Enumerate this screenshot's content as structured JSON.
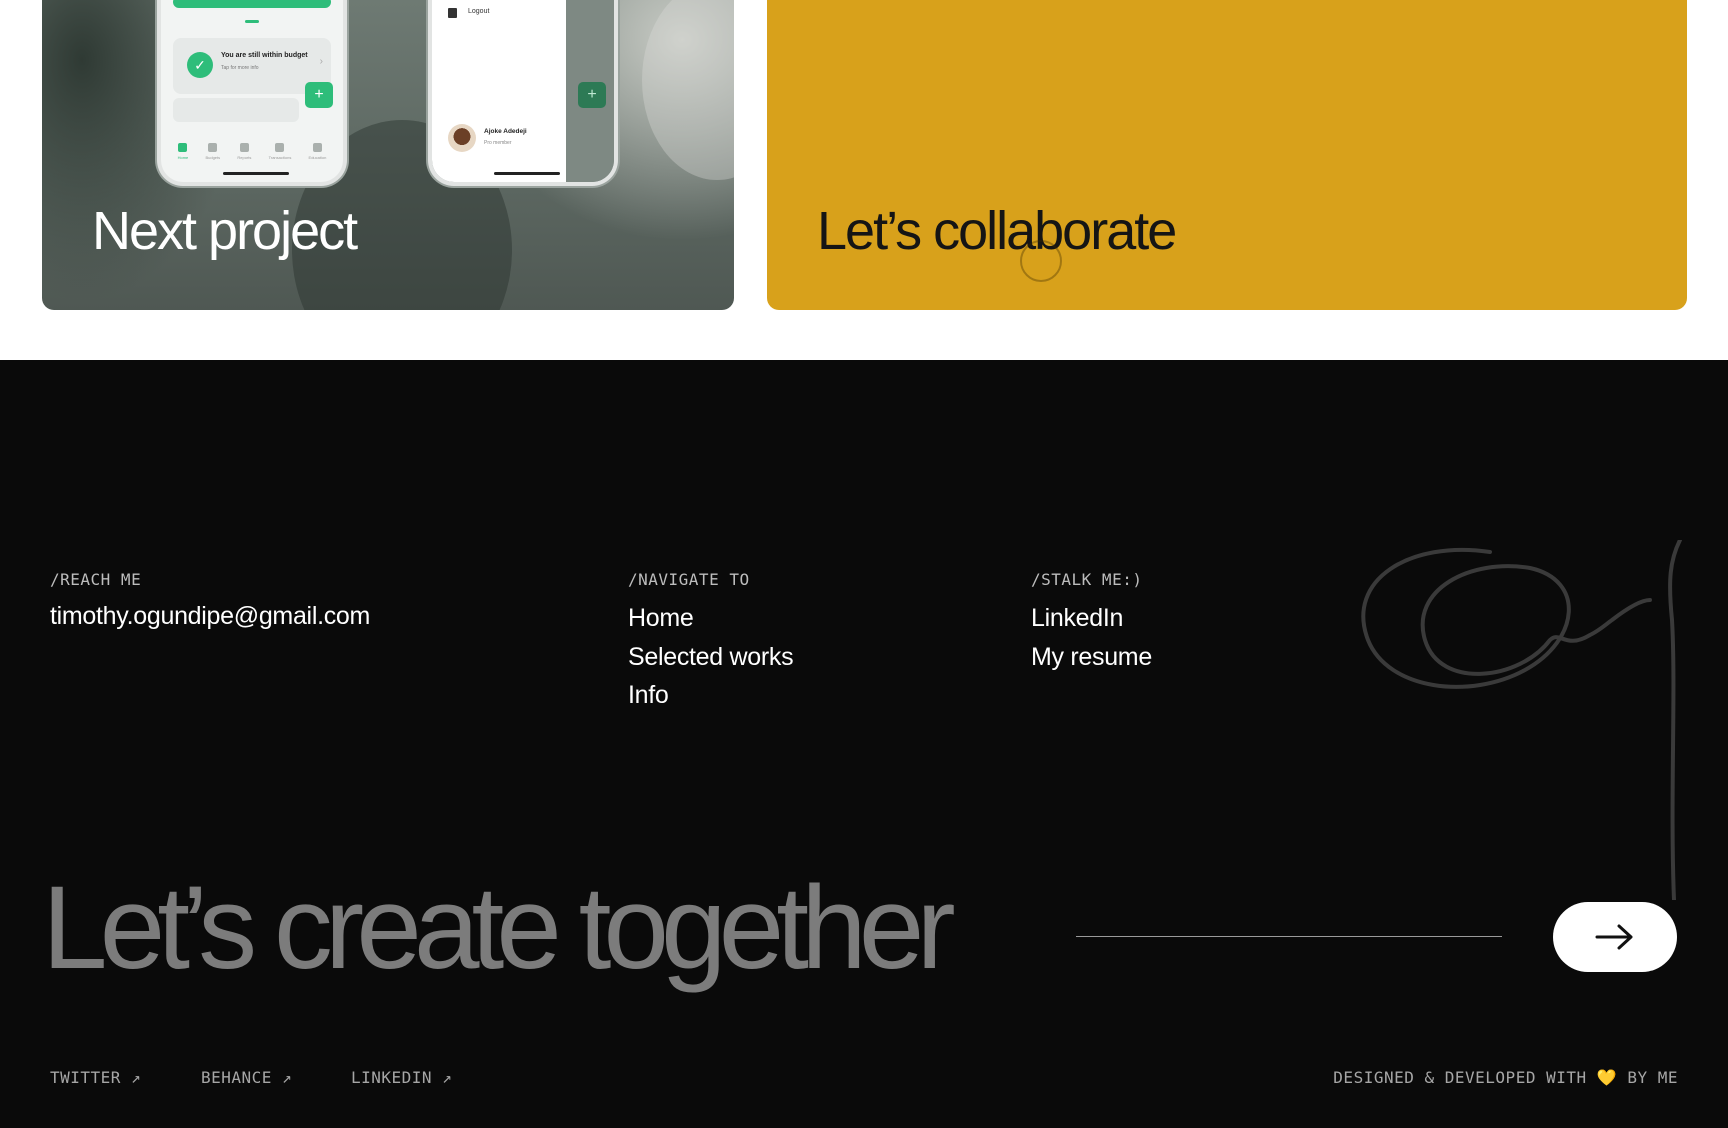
{
  "cards": {
    "next_project": "Next project",
    "collaborate": "Let’s collaborate"
  },
  "phone1": {
    "budget_title": "You are still within budget",
    "budget_sub": "Tap for more info",
    "nav": [
      "Home",
      "Budgets",
      "Reports",
      "Transactions",
      "Education"
    ]
  },
  "phone2": {
    "logout": "Logout",
    "user_name": "Ajoke Adedeji",
    "user_sub": "Pro member"
  },
  "footer": {
    "reach": {
      "label": "/REACH ME",
      "email": "timothy.ogundipe@gmail.com"
    },
    "navigate": {
      "label": "/NAVIGATE TO",
      "links": [
        "Home",
        "Selected works",
        "Info"
      ]
    },
    "stalk": {
      "label": "/STALK ME:)",
      "links": [
        "LinkedIn",
        "My resume"
      ]
    },
    "cta": "Let’s create together",
    "bottom_links": [
      "TWITTER ↗",
      "BEHANCE ↗",
      "LINKEDIN ↗"
    ],
    "credit_prefix": "DESIGNED & DEVELOPED WITH",
    "credit_heart": "💛",
    "credit_suffix": "BY ME"
  },
  "colors": {
    "collab_yellow": "#d8a11b",
    "footer_bg": "#0a0a0a",
    "accent_green": "#2ebd7a"
  },
  "icons": {
    "cta_button": "arrow-right-icon",
    "budget_check": "check-icon",
    "add": "plus-icon"
  }
}
